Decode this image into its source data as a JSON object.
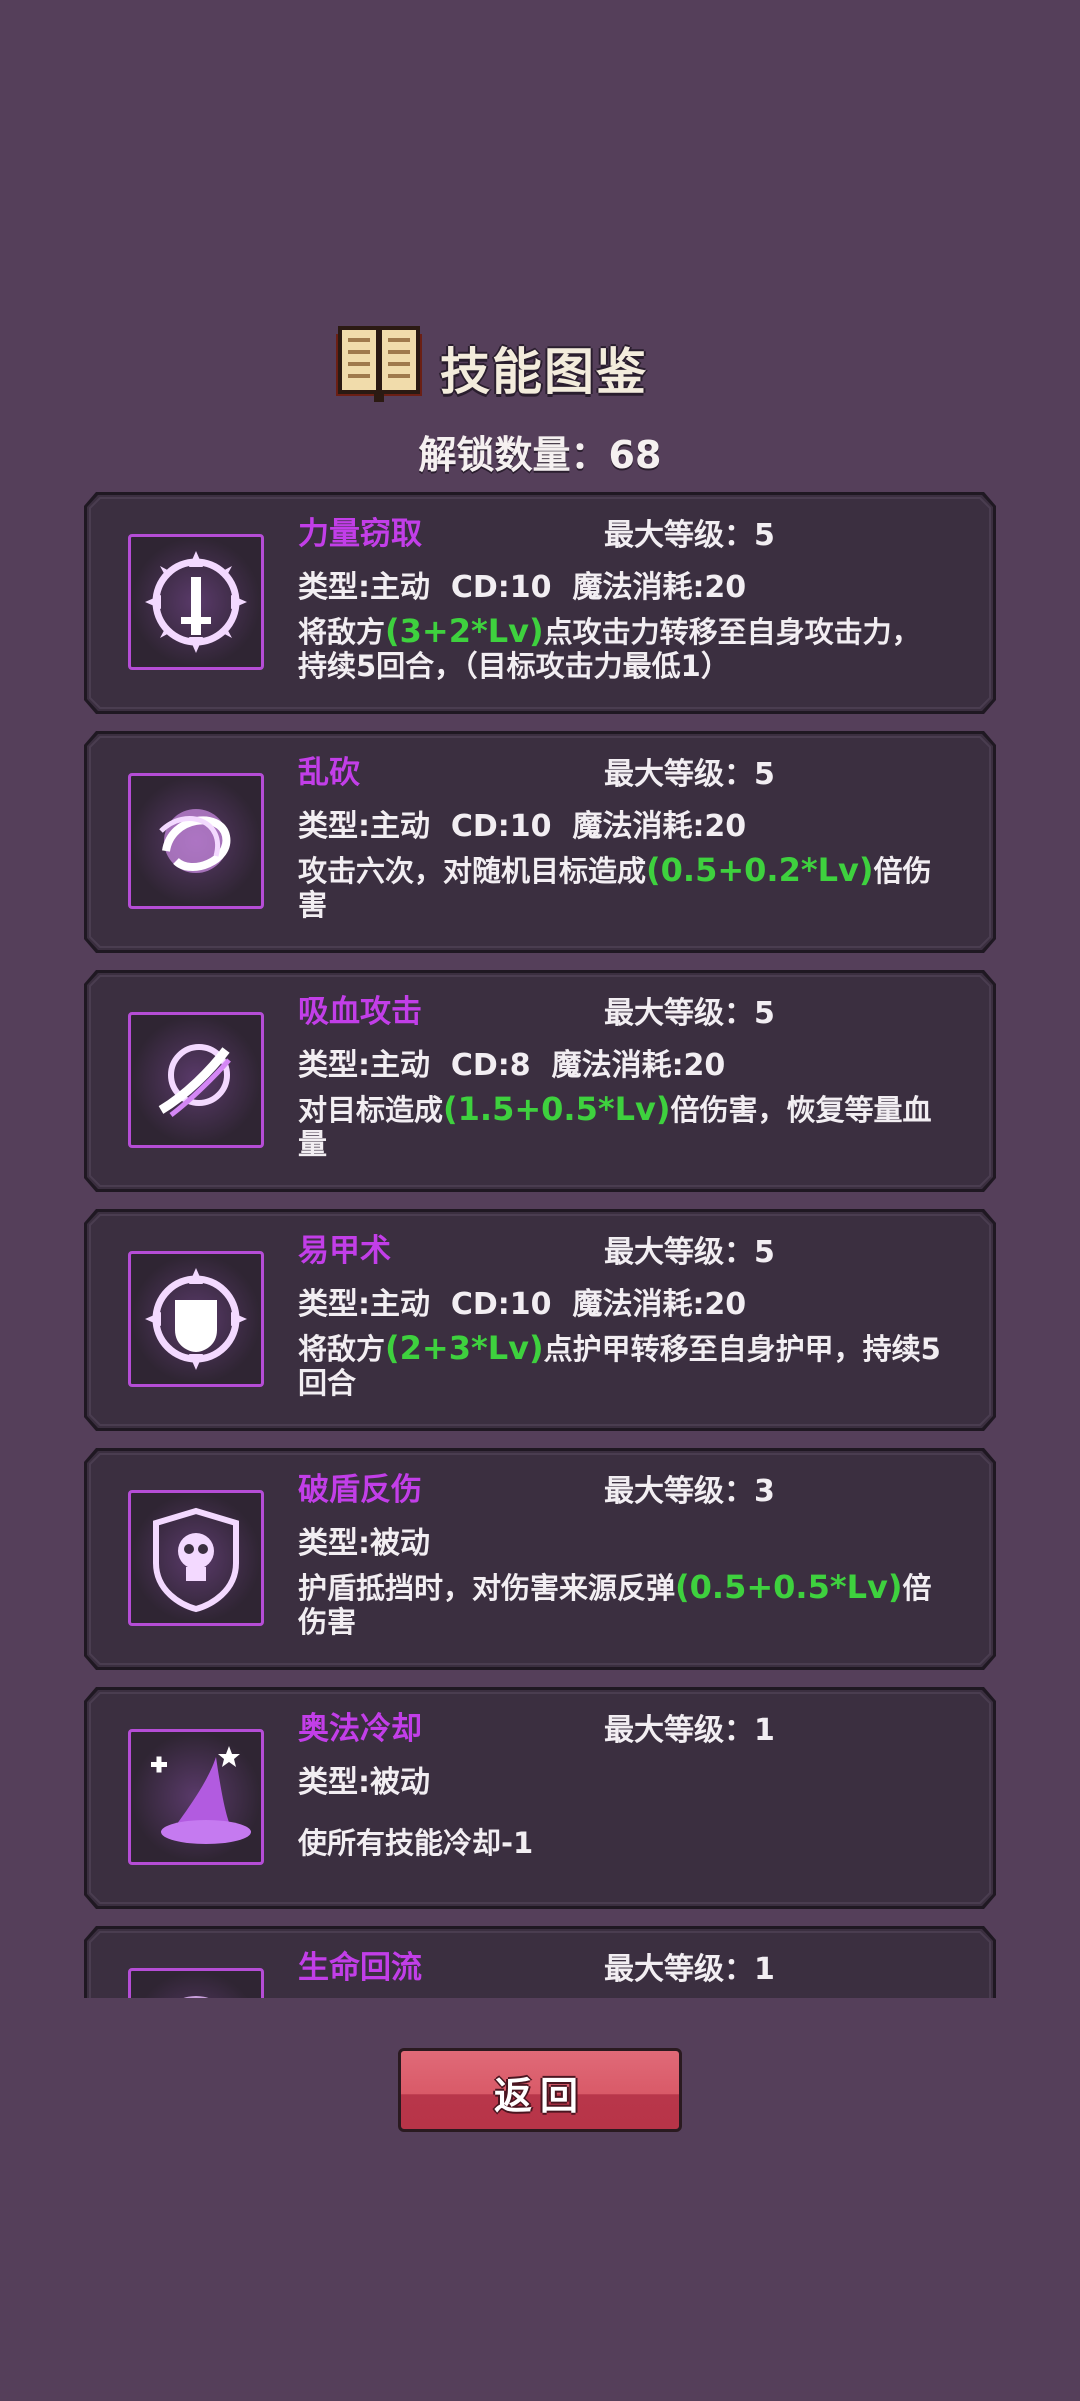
{
  "header": {
    "title": "技能图鉴",
    "icon": "book-icon",
    "unlock_label": "解锁数量：68"
  },
  "skills": [
    {
      "name": "力量窃取",
      "max_level": "最大等级：5",
      "meta": "类型:主动  CD:10  魔法消耗:20",
      "desc_pre": "将敌方",
      "desc_hl": "(3+2*Lv)",
      "desc_post": "点攻击力转移至自身攻击力，持续5回合，（目标攻击力最低1）",
      "icon": "sword-sun-icon"
    },
    {
      "name": "乱砍",
      "max_level": "最大等级：5",
      "meta": "类型:主动  CD:10  魔法消耗:20",
      "desc_pre": "攻击六次，对随机目标造成",
      "desc_hl": "(0.5+0.2*Lv)",
      "desc_post": "倍伤害",
      "icon": "slash-swirl-icon"
    },
    {
      "name": "吸血攻击",
      "max_level": "最大等级：5",
      "meta": "类型:主动  CD:8  魔法消耗:20",
      "desc_pre": "对目标造成",
      "desc_hl": "(1.5+0.5*Lv)",
      "desc_post": "倍伤害，恢复等量血量",
      "icon": "vampire-strike-icon"
    },
    {
      "name": "易甲术",
      "max_level": "最大等级：5",
      "meta": "类型:主动  CD:10  魔法消耗:20",
      "desc_pre": "将敌方",
      "desc_hl": "(2+3*Lv)",
      "desc_post": "点护甲转移至自身护甲，持续5回合",
      "icon": "armor-sun-icon"
    },
    {
      "name": "破盾反伤",
      "max_level": "最大等级：3",
      "meta": "类型:被动",
      "desc_pre": "护盾抵挡时，对伤害来源反弹",
      "desc_hl": "(0.5+0.5*Lv)",
      "desc_post": "倍伤害",
      "icon": "skull-shield-icon"
    },
    {
      "name": "奥法冷却",
      "max_level": "最大等级：1",
      "meta": "类型:被动",
      "desc_pre": "使所有技能冷却-1",
      "desc_hl": "",
      "desc_post": "",
      "icon": "wizard-hat-icon"
    },
    {
      "name": "生命回流",
      "max_level": "最大等级：1",
      "meta": "",
      "desc_pre": "",
      "desc_hl": "",
      "desc_post": "",
      "icon": "life-orb-icon"
    }
  ],
  "footer": {
    "back_label": "返回"
  },
  "colors": {
    "background": "#553f5a",
    "card": "#3b2f40",
    "skill_name": "#c23ee8",
    "formula": "#3ed13e",
    "button": "#d95a68"
  }
}
